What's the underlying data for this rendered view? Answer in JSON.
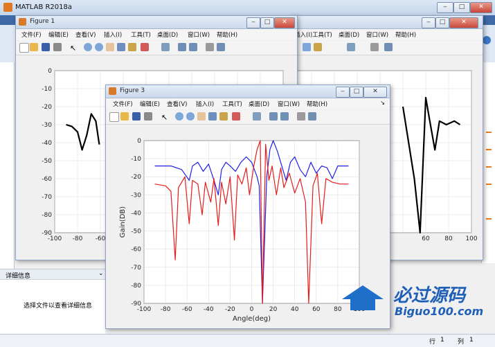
{
  "main_window": {
    "title": "MATLAB R2018a"
  },
  "detail_panel": {
    "header": "详细信息",
    "message": "选择文件以查看详细信息"
  },
  "statusbar": {
    "row_label": "行",
    "row_value": "1",
    "col_label": "列",
    "col_value": "1"
  },
  "watermark": {
    "text": "必过源码",
    "subtext": "Biguo100.com"
  },
  "menu": [
    "文件(F)",
    "编辑(E)",
    "查看(V)",
    "插入(I)",
    "工具(T)",
    "桌面(D)",
    "窗口(W)",
    "帮助(H)"
  ],
  "figures": [
    {
      "title": "Figure 1"
    },
    {
      "title": "Figure 3"
    }
  ],
  "colors": {
    "black_line": "#000000",
    "blue_line": "#1f1fe6",
    "red_line": "#e61a1a"
  },
  "chart_data": [
    {
      "type": "line",
      "figure": "Figure 1",
      "ylim": [
        -90,
        0
      ],
      "xlim": [
        -100,
        100
      ],
      "xticks": [
        "-100",
        "-80",
        "-60"
      ],
      "yticks": [
        "0",
        "-10",
        "-20",
        "-30",
        "-40",
        "-50",
        "-60",
        "-70",
        "-80",
        "-90"
      ],
      "grid": true,
      "series": [
        {
          "color": "#000000",
          "x": [
            -90,
            -85,
            -80,
            -76,
            -72,
            -68,
            -64,
            -61
          ],
          "y": [
            -30,
            -31,
            -34,
            -44,
            -36,
            -24,
            -28,
            -41
          ]
        }
      ]
    },
    {
      "type": "line",
      "figure": "Figure 3",
      "xlabel": "Angle(deg)",
      "ylabel": "Gain(DB)",
      "xlim": [
        -100,
        100
      ],
      "ylim": [
        -90,
        0
      ],
      "xticks": [
        "-100",
        "-80",
        "-60",
        "-40",
        "-20",
        "0",
        "20",
        "40",
        "60",
        "80",
        "100"
      ],
      "yticks": [
        "0",
        "-10",
        "-20",
        "-30",
        "-40",
        "-50",
        "-60",
        "-70",
        "-80",
        "-90"
      ],
      "grid": true,
      "series": [
        {
          "color": "#1f1fe6",
          "x": [
            -90,
            -75,
            -65,
            -58,
            -55,
            -50,
            -45,
            -40,
            -35,
            -31,
            -28,
            -24,
            -20,
            -15,
            -10,
            -5,
            0,
            5,
            7,
            10,
            14,
            17,
            20,
            24,
            28,
            32,
            36,
            40,
            45,
            50,
            55,
            60,
            65,
            70,
            75,
            80,
            85,
            90
          ],
          "y": [
            -14,
            -14,
            -16,
            -22,
            -14,
            -12,
            -17,
            -13,
            -22,
            -30,
            -16,
            -12,
            -14,
            -17,
            -12,
            -9,
            -12,
            -20,
            -25,
            -90,
            -20,
            -5,
            0,
            -6,
            -14,
            -22,
            -12,
            -9,
            -16,
            -20,
            -12,
            -18,
            -14,
            -15,
            -21,
            -14,
            -14,
            -14
          ]
        },
        {
          "color": "#e61a1a",
          "x": [
            -90,
            -80,
            -75,
            -71,
            -68,
            -62,
            -58,
            -55,
            -50,
            -46,
            -43,
            -38,
            -35,
            -31,
            -28,
            -24,
            -20,
            -16,
            -13,
            -9,
            -5,
            -2,
            2,
            5,
            8,
            10,
            13,
            16,
            19,
            23,
            27,
            30,
            35,
            40,
            45,
            50,
            53,
            57,
            61,
            65,
            69,
            75,
            82,
            90
          ],
          "y": [
            -24,
            -25,
            -28,
            -66,
            -26,
            -20,
            -46,
            -22,
            -24,
            -41,
            -23,
            -34,
            -21,
            -47,
            -23,
            -35,
            -20,
            -55,
            -19,
            -24,
            -15,
            -30,
            -14,
            -5,
            0,
            -90,
            -2,
            -22,
            -14,
            -30,
            -15,
            -26,
            -18,
            -29,
            -21,
            -34,
            -90,
            -25,
            -18,
            -46,
            -21,
            -23,
            -24,
            -24
          ]
        }
      ]
    },
    {
      "type": "line",
      "figure": "Figure (background right)",
      "xlim": [
        -100,
        100
      ],
      "ylim": [
        -90,
        0
      ],
      "xticks": [
        "60",
        "80",
        "100"
      ],
      "grid": true,
      "series": [
        {
          "color": "#000000",
          "x": [
            40,
            50,
            55,
            60,
            63,
            68,
            72,
            78,
            85,
            90
          ],
          "y": [
            -20,
            -60,
            -90,
            -15,
            -26,
            -44,
            -28,
            -30,
            -28,
            -30
          ]
        }
      ]
    }
  ]
}
